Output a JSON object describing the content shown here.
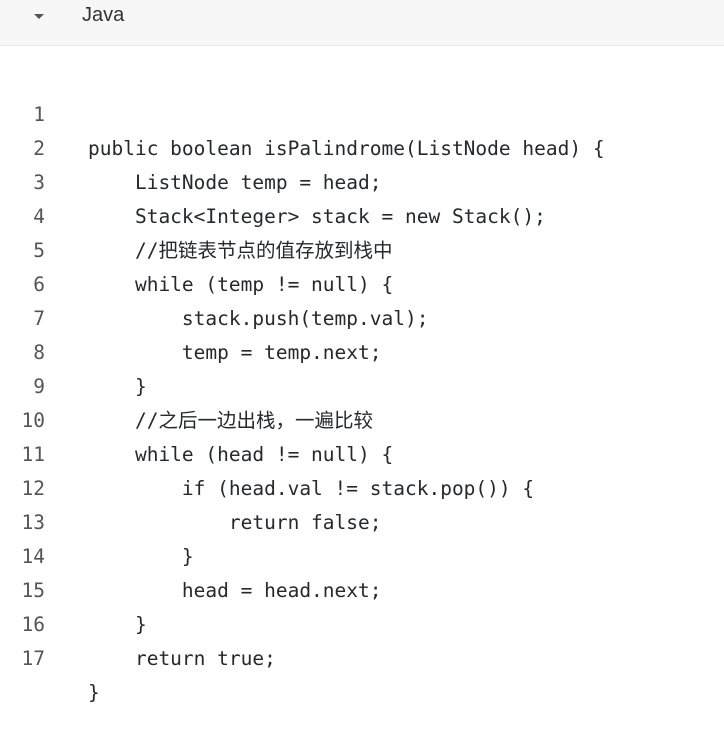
{
  "header": {
    "language": "Java",
    "toggle_icon": "triangle-down-icon"
  },
  "code": {
    "lines": [
      {
        "number": "1",
        "text": "public boolean isPalindrome(ListNode head) {"
      },
      {
        "number": "2",
        "text": "    ListNode temp = head;"
      },
      {
        "number": "3",
        "text": "    Stack<Integer> stack = new Stack();"
      },
      {
        "number": "4",
        "text": "    //把链表节点的值存放到栈中"
      },
      {
        "number": "5",
        "text": "    while (temp != null) {"
      },
      {
        "number": "6",
        "text": "        stack.push(temp.val);"
      },
      {
        "number": "7",
        "text": "        temp = temp.next;"
      },
      {
        "number": "8",
        "text": "    }"
      },
      {
        "number": "9",
        "text": "    //之后一边出栈，一遍比较"
      },
      {
        "number": "10",
        "text": "    while (head != null) {"
      },
      {
        "number": "11",
        "text": "        if (head.val != stack.pop()) {"
      },
      {
        "number": "12",
        "text": "            return false;"
      },
      {
        "number": "13",
        "text": "        }"
      },
      {
        "number": "14",
        "text": "        head = head.next;"
      },
      {
        "number": "15",
        "text": "    }"
      },
      {
        "number": "16",
        "text": "    return true;"
      },
      {
        "number": "17",
        "text": "}"
      }
    ]
  }
}
